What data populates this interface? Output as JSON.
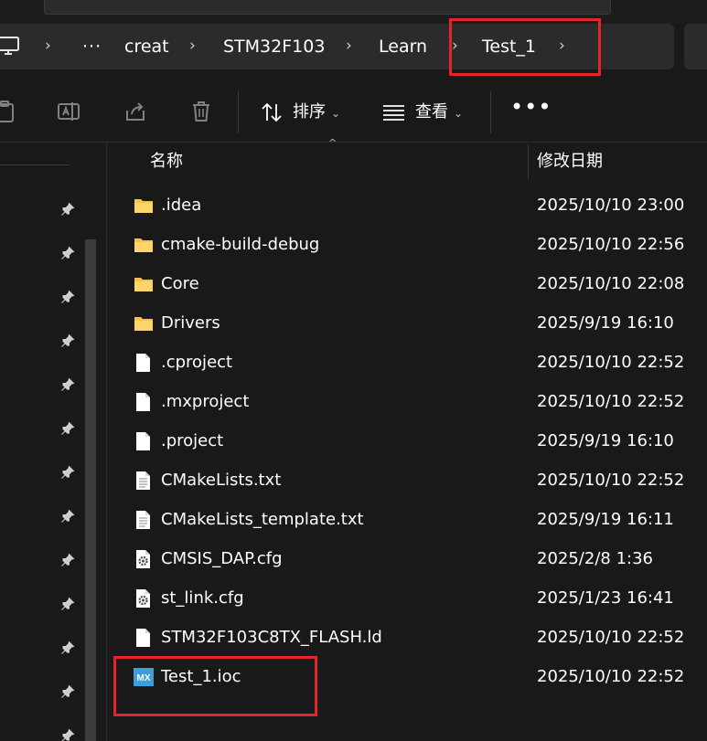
{
  "breadcrumb": {
    "overflow": "···",
    "items": [
      "creat",
      "STM32F103",
      "Learn",
      "Test_1"
    ]
  },
  "toolbar": {
    "sort_label": "排序",
    "view_label": "查看",
    "more_label": "•••",
    "icons": [
      "paste-icon",
      "rename-icon",
      "share-icon",
      "delete-icon",
      "sort-icon",
      "view-icon"
    ]
  },
  "columns": {
    "name": "名称",
    "date_modified": "修改日期"
  },
  "files": [
    {
      "name": ".idea",
      "date": "2025/10/10 23:00",
      "type": "folder"
    },
    {
      "name": "cmake-build-debug",
      "date": "2025/10/10 22:56",
      "type": "folder"
    },
    {
      "name": "Core",
      "date": "2025/10/10 22:08",
      "type": "folder"
    },
    {
      "name": "Drivers",
      "date": "2025/9/19 16:10",
      "type": "folder"
    },
    {
      "name": ".cproject",
      "date": "2025/10/10 22:52",
      "type": "file"
    },
    {
      "name": ".mxproject",
      "date": "2025/10/10 22:52",
      "type": "file"
    },
    {
      "name": ".project",
      "date": "2025/9/19 16:10",
      "type": "file"
    },
    {
      "name": "CMakeLists.txt",
      "date": "2025/10/10 22:52",
      "type": "text"
    },
    {
      "name": "CMakeLists_template.txt",
      "date": "2025/9/19 16:11",
      "type": "text"
    },
    {
      "name": "CMSIS_DAP.cfg",
      "date": "2025/2/8 1:36",
      "type": "config"
    },
    {
      "name": "st_link.cfg",
      "date": "2025/1/23 16:41",
      "type": "config"
    },
    {
      "name": "STM32F103C8TX_FLASH.ld",
      "date": "2025/10/10 22:52",
      "type": "file"
    },
    {
      "name": "Test_1.ioc",
      "date": "2025/10/10 22:52",
      "type": "mx",
      "mx_badge": "MX"
    }
  ],
  "colors": {
    "highlight": "#e3242b",
    "folder": "#f4c44a",
    "mx_badge": "#3aa0dc"
  }
}
